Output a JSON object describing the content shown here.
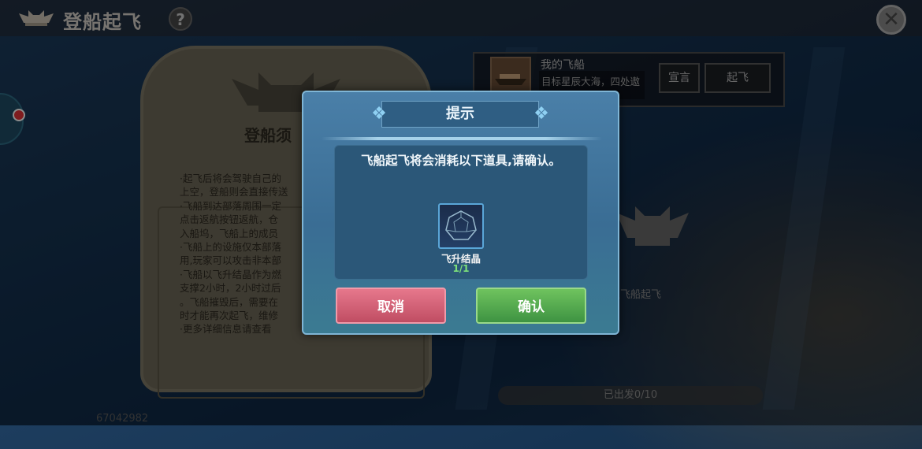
{
  "header": {
    "title": "登船起飞",
    "help_icon": "?",
    "close_icon": "✕"
  },
  "rules_panel": {
    "title": "登船须",
    "lines": [
      "·起飞后将会驾驶自己的",
      "上空，登船则会直接传送",
      "·飞船到达部落周围一定",
      "点击返航按钮返航，仓",
      "入船坞，飞船上的成员",
      "·飞船上的设施仅本部落",
      "用,玩家可以攻击非本部",
      "·飞船以飞升结晶作为燃",
      "支撑2小时，2小时过后",
      "。飞船摧毁后，需要在",
      "时才能再次起飞，维修",
      "·更多详细信息请查看"
    ]
  },
  "ship": {
    "name": "我的飞船",
    "desc": "目标星辰大海，四处遨游风雅！",
    "declare_label": "宣言",
    "takeoff_label": "起飞"
  },
  "alone_text": "独飞船起飞",
  "progress_text": "已出发0/10",
  "user_id": "67042982",
  "modal": {
    "title": "提示",
    "message": "飞船起飞将会消耗以下道具,请确认。",
    "item_name": "飞升结晶",
    "item_count": "1/1",
    "cancel_label": "取消",
    "confirm_label": "确认"
  },
  "colors": {
    "cancel": "#d0627a",
    "confirm": "#52a94d",
    "modal_bg": "#3f739b"
  }
}
